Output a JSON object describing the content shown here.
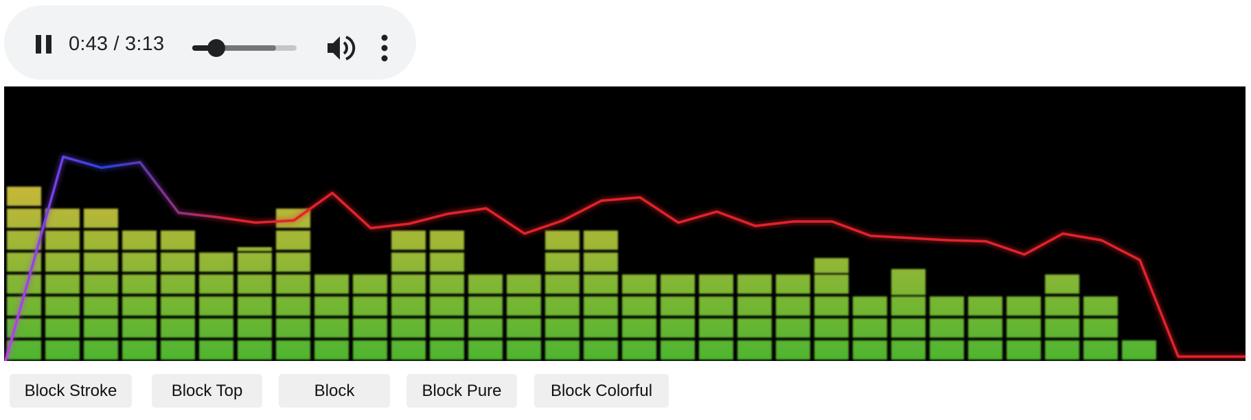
{
  "player": {
    "state": "playing",
    "pause_icon": "pause-icon",
    "current_time": "0:43",
    "separator": "/",
    "duration": "3:13",
    "progress": 0.227,
    "buffered": 0.8,
    "volume_icon": "volume-up-icon",
    "menu_icon": "more-vert-icon"
  },
  "visualizer": {
    "levels": [
      8,
      7,
      7,
      6,
      6,
      5,
      5,
      7,
      4,
      4,
      6,
      6,
      4,
      4,
      6,
      6,
      4,
      4,
      4,
      4,
      4,
      4,
      3,
      3,
      3,
      3,
      3,
      4,
      3,
      1
    ],
    "fractional_tops": {
      "5": 4.5,
      "6": 5.25,
      "21": 4.75,
      "23": 4.25
    },
    "max_level": 8,
    "peak_line": [
      0,
      9.3,
      8.8,
      9.05,
      6.75,
      6.55,
      6.3,
      6.4,
      7.65,
      6.05,
      6.25,
      6.7,
      6.95,
      5.8,
      6.4,
      7.3,
      7.45,
      6.3,
      6.8,
      6.15,
      6.35,
      6.35,
      5.7,
      5.6,
      5.5,
      5.45,
      4.85,
      5.8,
      5.5,
      4.6,
      0.2,
      0.2,
      0.2
    ],
    "colors": {
      "background": "#000000",
      "bar_bottom": "#4db52f",
      "bar_top": "#e6b83c",
      "peak_start": "#c043e6",
      "peak_mid": "#2b3fe0",
      "peak_end": "#e3242b"
    }
  },
  "modes": [
    {
      "label": "Block Stroke"
    },
    {
      "label": "Block Top"
    },
    {
      "label": "Block"
    },
    {
      "label": "Block Pure"
    },
    {
      "label": "Block Colorful"
    }
  ]
}
